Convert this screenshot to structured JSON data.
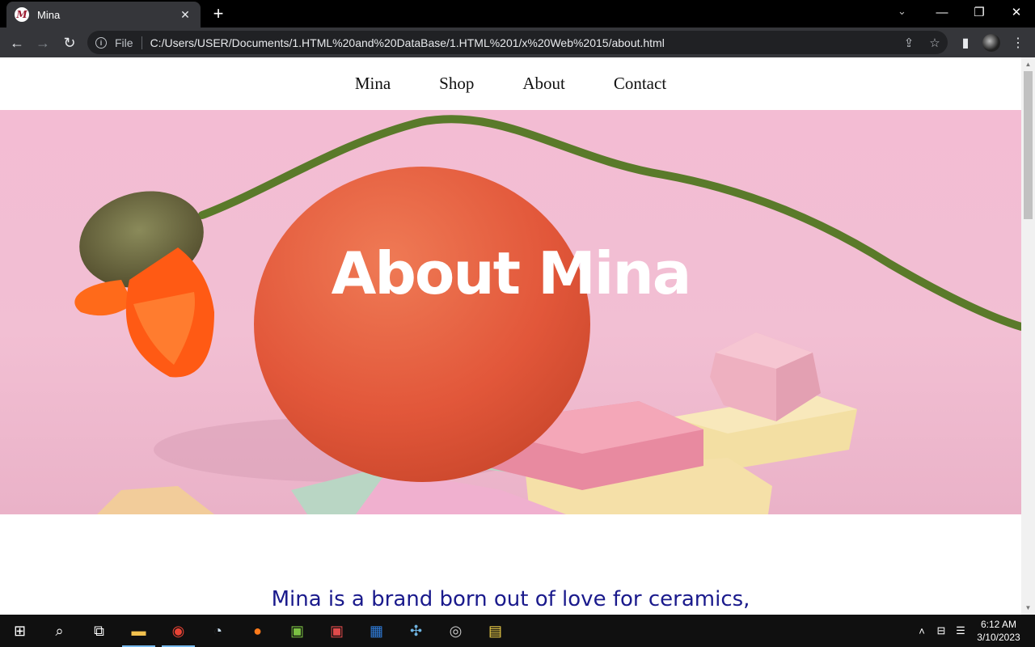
{
  "browser": {
    "tab_title": "Mina",
    "tab_favicon": "M",
    "address_prefix": "File",
    "url": "C:/Users/USER/Documents/1.HTML%20and%20DataBase/1.HTML%201/x%20Web%2015/about.html"
  },
  "site": {
    "nav": [
      "Mina",
      "Shop",
      "About",
      "Contact"
    ],
    "hero_title": "About Mina",
    "intro_text": "Mina is a brand born out of love for ceramics,"
  },
  "taskbar": {
    "time": "6:12 AM",
    "date": "3/10/2023"
  },
  "colors": {
    "hero_background": "#f3bcd3",
    "vase": "#e2573a",
    "intro_text": "#1a1a8c"
  }
}
